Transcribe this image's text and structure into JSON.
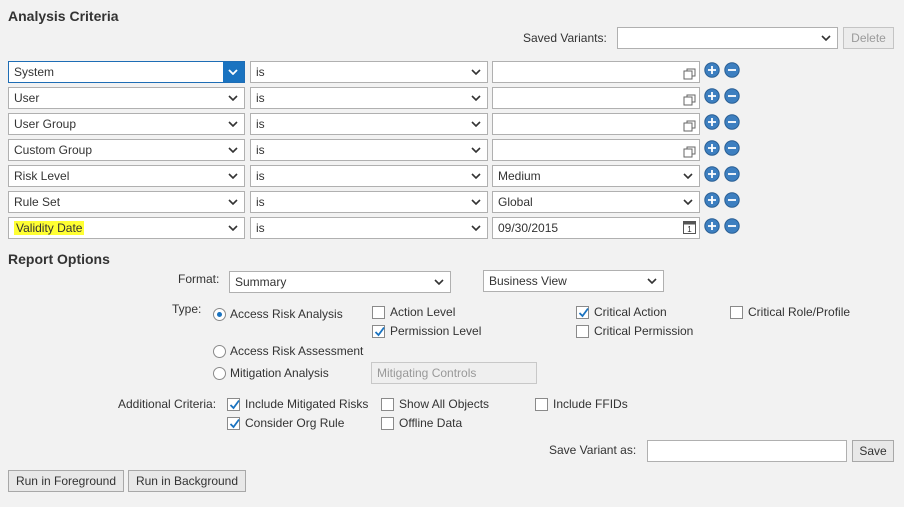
{
  "analysis": {
    "title": "Analysis Criteria",
    "saved_variants_label": "Saved Variants:",
    "saved_variants_value": "",
    "delete_label": "Delete",
    "rows": [
      {
        "field": "System",
        "op": "is",
        "value": ""
      },
      {
        "field": "User",
        "op": "is",
        "value": ""
      },
      {
        "field": "User Group",
        "op": "is",
        "value": ""
      },
      {
        "field": "Custom Group",
        "op": "is",
        "value": ""
      },
      {
        "field": "Risk Level",
        "op": "is",
        "value": "Medium"
      },
      {
        "field": "Rule Set",
        "op": "is",
        "value": "Global"
      },
      {
        "field": "Validity Date",
        "op": "is",
        "value": "09/30/2015"
      }
    ]
  },
  "report": {
    "title": "Report Options",
    "format_label": "Format:",
    "format_value": "Summary",
    "view_value": "Business View",
    "type_label": "Type:",
    "types": [
      {
        "label": "Access Risk Analysis",
        "selected": true
      },
      {
        "label": "Access Risk Assessment",
        "selected": false
      },
      {
        "label": "Mitigation Analysis",
        "selected": false
      }
    ],
    "mitigating_controls_label": "Mitigating Controls",
    "levels": [
      {
        "label": "Action Level",
        "checked": false
      },
      {
        "label": "Permission Level",
        "checked": true
      },
      {
        "label": "Critical Action",
        "checked": true
      },
      {
        "label": "Critical Permission",
        "checked": false
      },
      {
        "label": "Critical Role/Profile",
        "checked": false
      }
    ],
    "additional_label": "Additional Criteria:",
    "additional": [
      {
        "label": "Include Mitigated Risks",
        "checked": true
      },
      {
        "label": "Show All Objects",
        "checked": false
      },
      {
        "label": "Include FFIDs",
        "checked": false
      },
      {
        "label": "Consider Org Rule",
        "checked": true
      },
      {
        "label": "Offline Data",
        "checked": false
      }
    ],
    "save_variant_label": "Save Variant as:",
    "save_variant_value": "",
    "save_label": "Save"
  },
  "actions": {
    "run_foreground": "Run in Foreground",
    "run_background": "Run in Background"
  },
  "colors": {
    "accent": "#1a73c0",
    "highlight": "#ffff33",
    "background": "#f2f2f2"
  }
}
